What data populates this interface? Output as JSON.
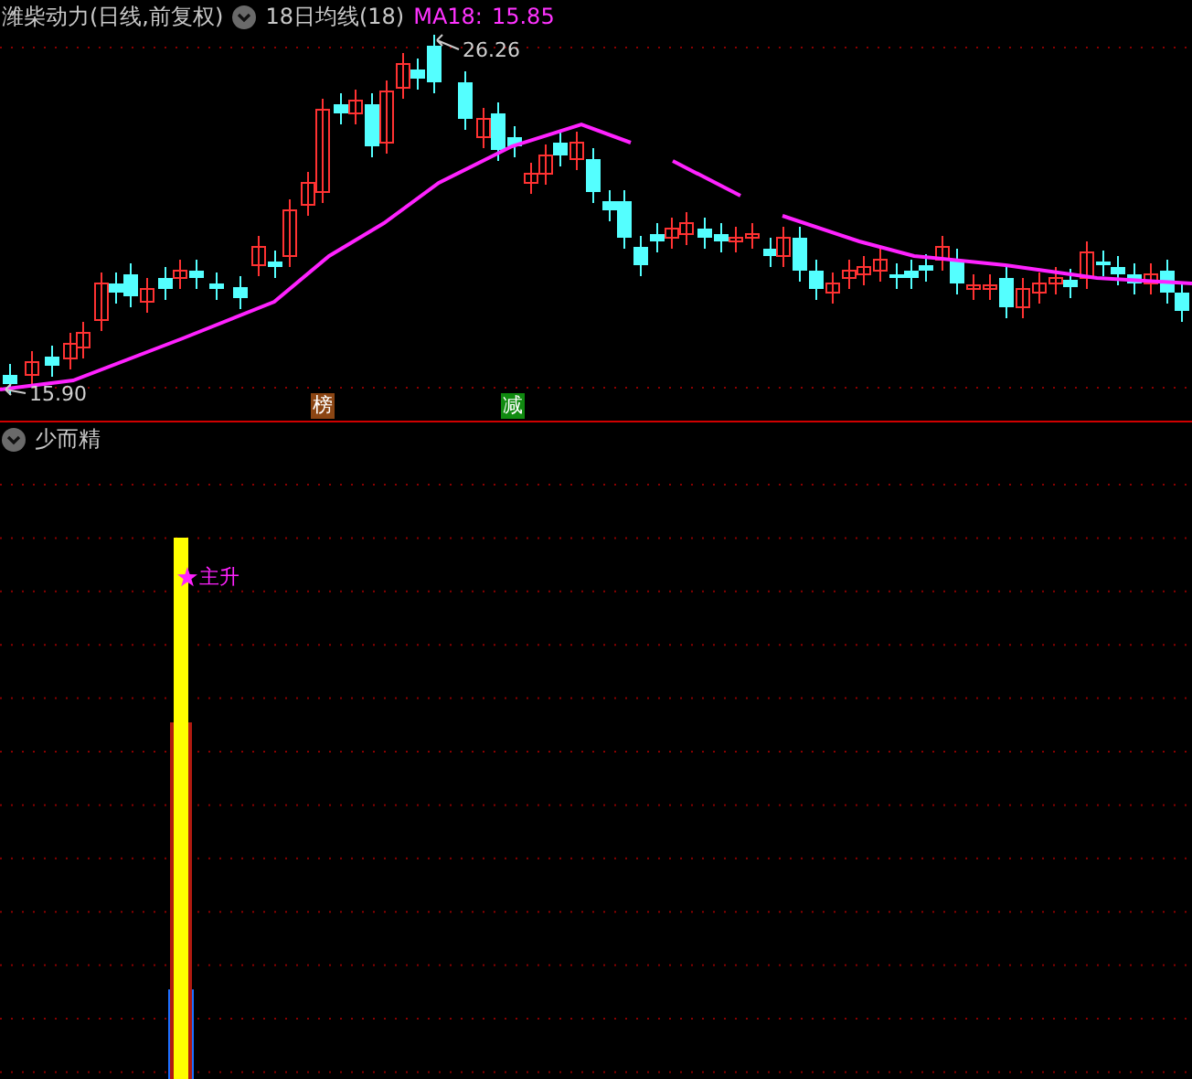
{
  "price_pane": {
    "title": "潍柴动力(日线,前复权)",
    "indicator": "18日均线(18)",
    "ma_label": "MA18:",
    "ma_value": "15.85",
    "high_label": "26.26",
    "low_label": "15.90",
    "markers": [
      {
        "text": "榜",
        "color": "#8b4513"
      },
      {
        "text": "减",
        "color": "#108a10"
      }
    ]
  },
  "signal_pane": {
    "title": "少而精",
    "signal_label": "主升"
  }
}
